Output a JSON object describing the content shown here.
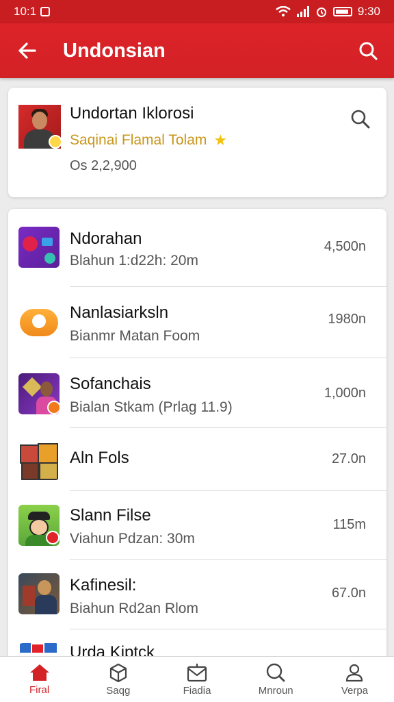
{
  "status": {
    "time_left": "10:1",
    "time_right": "9:30"
  },
  "app_bar": {
    "title": "Undonsian"
  },
  "profile": {
    "name": "Undortan Iklorosi",
    "subtitle": "Saqinai Flamal Tolam",
    "count": "Os 2,2,900"
  },
  "list": [
    {
      "title": "Ndorahan",
      "subtitle": "Blahun 1:d22h: 20m",
      "value": "4,500n"
    },
    {
      "title": "Nanlasiarksln",
      "subtitle": "Bianmr Matan Foom",
      "value": "1980n"
    },
    {
      "title": "Sofanchais",
      "subtitle": "Bialan Stkam (Prlag 11.9)",
      "value": "1,000n"
    },
    {
      "title": "Aln Fols",
      "subtitle": "",
      "value": "27.0n"
    },
    {
      "title": "Slann Filse",
      "subtitle": "Viahun Pdzan: 30m",
      "value": "115m"
    },
    {
      "title": "Kafinesil:",
      "subtitle": "Biahun Rd2an Rlom",
      "value": "67.0n"
    },
    {
      "title": "Urda Kiptck",
      "subtitle": "",
      "value": ""
    }
  ],
  "nav": [
    {
      "label": "Firal",
      "icon": "home-icon"
    },
    {
      "label": "Saqg",
      "icon": "box-icon"
    },
    {
      "label": "Fiadia",
      "icon": "mail-icon"
    },
    {
      "label": "Mnroun",
      "icon": "search-icon"
    },
    {
      "label": "Verpa",
      "icon": "person-icon"
    }
  ],
  "colors": {
    "primary": "#d32226",
    "status_bar": "#c81e22",
    "accent_star": "#f4c20d"
  }
}
